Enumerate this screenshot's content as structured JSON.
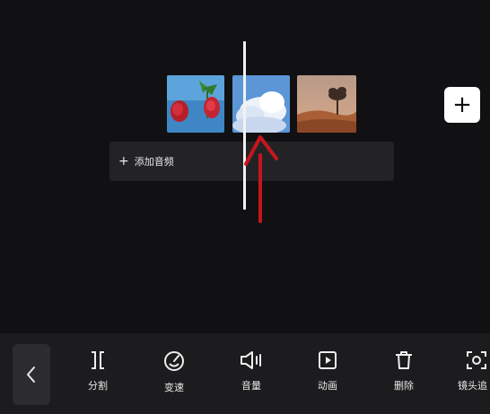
{
  "timeline": {
    "clips": [
      {
        "name": "clip-roses"
      },
      {
        "name": "clip-clouds"
      },
      {
        "name": "clip-tree-sunset"
      }
    ],
    "audio_track": {
      "plus": "+",
      "label": "添加音频"
    },
    "add_button_label": "+"
  },
  "toolbar": {
    "back_icon": "chevron-left-icon",
    "tools": [
      {
        "label": "分割",
        "icon": "split-icon"
      },
      {
        "label": "变速",
        "icon": "speed-icon"
      },
      {
        "label": "音量",
        "icon": "volume-icon"
      },
      {
        "label": "动画",
        "icon": "animation-icon"
      },
      {
        "label": "删除",
        "icon": "delete-icon"
      },
      {
        "label": "镜头追",
        "icon": "camera-track-icon"
      }
    ]
  },
  "colors": {
    "background": "#111113",
    "audio_track": "#232326",
    "toolbar": "#1c1c1e",
    "playhead": "#f2f2f2",
    "annotation_arrow": "#c4161c"
  }
}
